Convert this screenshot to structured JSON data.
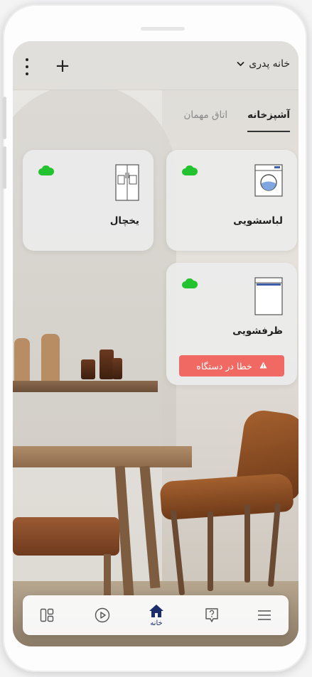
{
  "header": {
    "home_name": "خانه پدری",
    "chevron_icon": "chevron-down-icon",
    "add_label": "+",
    "menu_icon": "more-vertical-icon"
  },
  "tabs": [
    {
      "label": "آشپزخانه",
      "active": true
    },
    {
      "label": "اتاق مهمان",
      "active": false
    }
  ],
  "devices": [
    {
      "name": "لباسشویی",
      "icon": "washing-machine-icon",
      "cloud_icon": "cloud-online-icon"
    },
    {
      "name": "یخچال",
      "icon": "fridge-icon",
      "cloud_icon": "cloud-online-icon"
    },
    {
      "name": "ظرفشویی",
      "icon": "dishwasher-icon",
      "cloud_icon": "cloud-online-icon",
      "error": "خطا در دستگاه"
    }
  ],
  "bottom_nav": [
    {
      "icon": "menu-icon"
    },
    {
      "icon": "support-icon"
    },
    {
      "icon": "home-icon",
      "label": "خانه",
      "active": true
    },
    {
      "icon": "play-icon"
    },
    {
      "icon": "dashboard-icon"
    }
  ],
  "colors": {
    "online": "#22c32e",
    "error": "#f06a63",
    "active_nav": "#1c2d6b"
  }
}
